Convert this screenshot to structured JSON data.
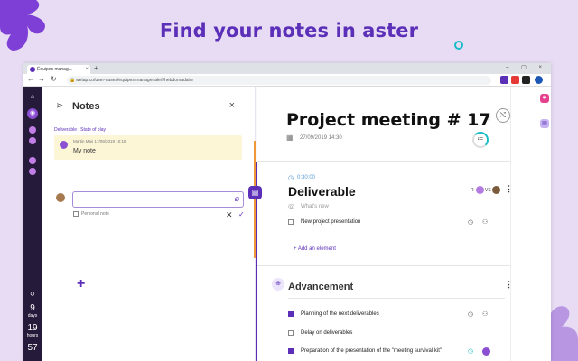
{
  "headline": "Find your notes in aster",
  "colors": {
    "brand_purple": "#5b2fb8",
    "rail_dark": "#261a3b",
    "note_bg": "#fcf6d7",
    "accent_orange": "#f29a3a",
    "accent_teal": "#1abcc8"
  },
  "browser": {
    "tab_title": "Équipes manag…",
    "tab_close": "×",
    "new_tab": "+",
    "window_controls": "– ▢ ×",
    "back": "←",
    "forward": "→",
    "reload": "↻",
    "lock": "🔒",
    "url": "wetap.co/user-cases/equipes-manageriale/#hebdomadaire"
  },
  "rail": {
    "home_icon": "⌂",
    "app_icon": "◉",
    "bottom_icon": "↺",
    "days_value": "9",
    "days_label": "days",
    "hours_value": "19",
    "hours_label": "hours",
    "minutes_value": "57"
  },
  "notes_panel": {
    "icon": "⋗",
    "title": "Notes",
    "close": "×",
    "section_label": "Deliverable : State of play",
    "note": {
      "meta": "Martin Mas   17/09/2019 10:18",
      "text": "My note"
    },
    "attach_icon": "⌀",
    "personal_note_label": "Personal note",
    "cancel": "✕",
    "confirm": "✓",
    "add": "+"
  },
  "marker_icon": "▤",
  "meeting": {
    "title": "Project meeting # 17",
    "date": "27/09/2019 14:30",
    "calendar_icon": "▦",
    "kebab": "⋮",
    "share_icon": "⤭",
    "progress_icon": "≔",
    "deliverable": {
      "clock_icon": "◷",
      "duration": "0:30:00",
      "title": "Deliverable",
      "owner_initial": "R",
      "vs": "VS",
      "target_icon": "◎",
      "whats_new": "What's new",
      "tasks": [
        {
          "label": "New project presentation",
          "checked": false
        }
      ],
      "add_element": "+ Add an element"
    },
    "advancement": {
      "icon": "⊕",
      "title": "Advancement",
      "tasks": [
        {
          "label": "Planning of the next deliverables",
          "checked": true
        },
        {
          "label": "Delay on deliverables",
          "checked": false
        },
        {
          "label": "Preparation of the presentation of the \"meeting survival kit\"",
          "checked": true
        }
      ]
    },
    "task_clock_icon": "◷",
    "task_user_icon": "⚇"
  },
  "strip": {
    "icon_1": "✱",
    "icon_2": "▤"
  }
}
